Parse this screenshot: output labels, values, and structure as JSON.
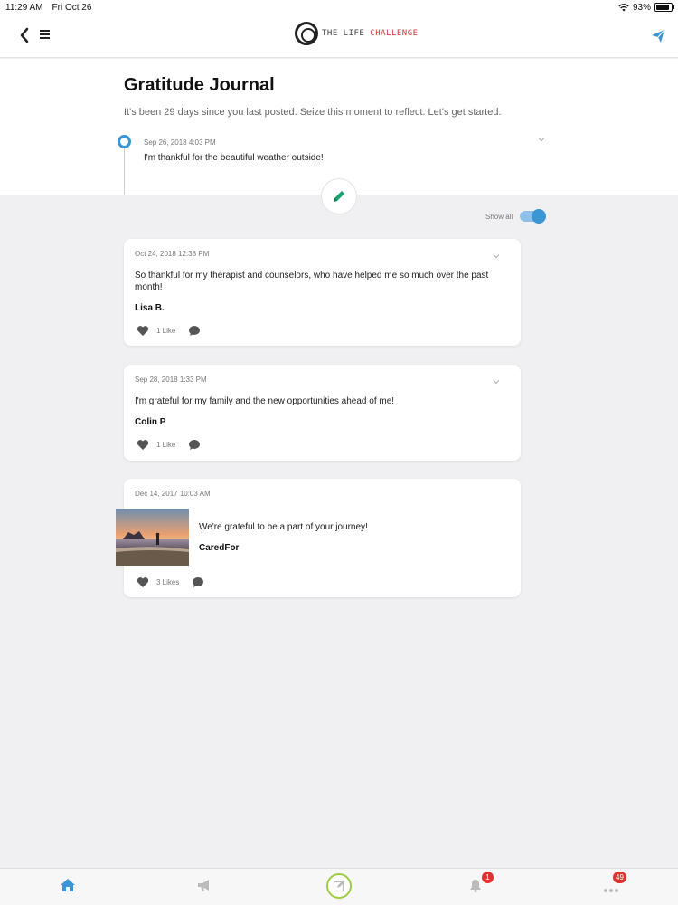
{
  "status_bar": {
    "time": "11:29 AM",
    "date": "Fri Oct 26",
    "battery": "93%"
  },
  "header": {
    "logo_text_part1": "THE LIFE",
    "logo_text_part2": "CHALLENGE"
  },
  "journal": {
    "title": "Gratitude Journal",
    "subtitle": "It's been 29 days since you last posted. Seize this moment to reflect. Let's get started.",
    "my_entry": {
      "date": "Sep 26, 2018 4:03 PM",
      "text": "I'm thankful for the beautiful weather outside!"
    },
    "show_all_label": "Show all"
  },
  "posts": [
    {
      "date": "Oct 24, 2018 12:38 PM",
      "text": "So thankful for my therapist and counselors, who have helped me so much over the past month!",
      "author": "Lisa B.",
      "likes": "1 Like"
    },
    {
      "date": "Sep 28, 2018 1:33 PM",
      "text": "I'm grateful for my family and the new opportunities ahead of me!",
      "author": "Colin P",
      "likes": "1 Like"
    },
    {
      "date": "Dec 14, 2017 10:03 AM",
      "text": "We're grateful to be a part of your journey!",
      "author": "CaredFor",
      "likes": "3 Likes"
    }
  ],
  "tabs": {
    "notifications_badge": "1",
    "more_badge": "49"
  },
  "colors": {
    "accent": "#3a97d4",
    "compose_green": "#1aa26b",
    "badge": "#e0332f",
    "tab_compose_ring": "#9ccc44"
  }
}
